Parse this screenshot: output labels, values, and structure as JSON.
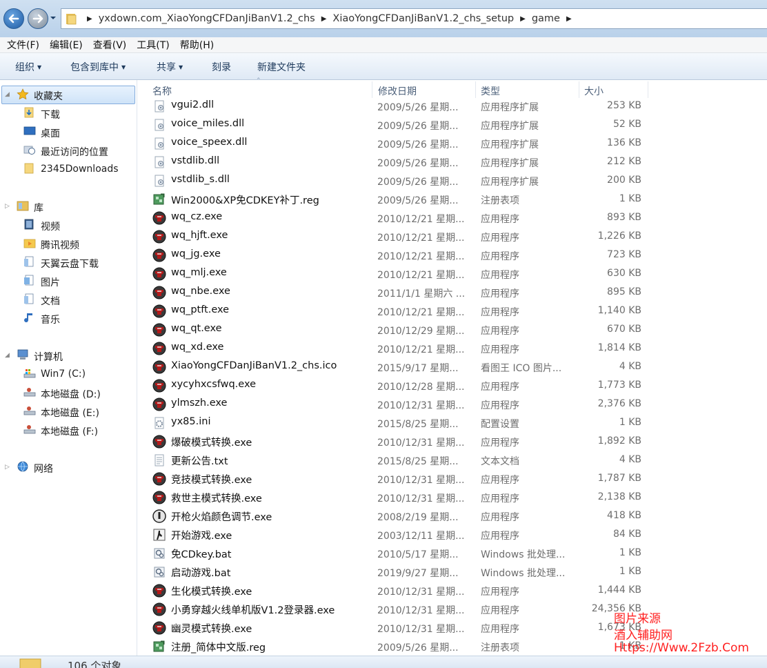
{
  "address_bar": {
    "crumbs": [
      "yxdown.com_XiaoYongCFDanJiBanV1.2_chs",
      "XiaoYongCFDanJiBanV1.2_chs_setup",
      "game"
    ]
  },
  "menu": [
    "文件(F)",
    "编辑(E)",
    "查看(V)",
    "工具(T)",
    "帮助(H)"
  ],
  "toolbar": {
    "organize": "组织",
    "include_library": "包含到库中",
    "share": "共享",
    "burn": "刻录",
    "new_folder": "新建文件夹"
  },
  "nav": {
    "favorites": "收藏夹",
    "fav_items": [
      "下载",
      "桌面",
      "最近访问的位置",
      "2345Downloads"
    ],
    "libraries": "库",
    "lib_items": [
      "视频",
      "腾讯视频",
      "天翼云盘下载",
      "图片",
      "文档",
      "音乐"
    ],
    "computer": "计算机",
    "drives": [
      "Win7 (C:)",
      "本地磁盘 (D:)",
      "本地磁盘 (E:)",
      "本地磁盘 (F:)"
    ],
    "network": "网络"
  },
  "columns": {
    "name": "名称",
    "date": "修改日期",
    "type": "类型",
    "size": "大小"
  },
  "files": [
    {
      "name": "vgui2.dll",
      "date": "2009/5/26 星期...",
      "type": "应用程序扩展",
      "size": "253 KB",
      "icon": "dll"
    },
    {
      "name": "voice_miles.dll",
      "date": "2009/5/26 星期...",
      "type": "应用程序扩展",
      "size": "52 KB",
      "icon": "dll"
    },
    {
      "name": "voice_speex.dll",
      "date": "2009/5/26 星期...",
      "type": "应用程序扩展",
      "size": "136 KB",
      "icon": "dll"
    },
    {
      "name": "vstdlib.dll",
      "date": "2009/5/26 星期...",
      "type": "应用程序扩展",
      "size": "212 KB",
      "icon": "dll"
    },
    {
      "name": "vstdlib_s.dll",
      "date": "2009/5/26 星期...",
      "type": "应用程序扩展",
      "size": "200 KB",
      "icon": "dll"
    },
    {
      "name": "Win2000&XP免CDKEY补丁.reg",
      "date": "2009/5/26 星期...",
      "type": "注册表项",
      "size": "1 KB",
      "icon": "reg"
    },
    {
      "name": "wq_cz.exe",
      "date": "2010/12/21 星期...",
      "type": "应用程序",
      "size": "893 KB",
      "icon": "exe"
    },
    {
      "name": "wq_hjft.exe",
      "date": "2010/12/21 星期...",
      "type": "应用程序",
      "size": "1,226 KB",
      "icon": "exe"
    },
    {
      "name": "wq_jg.exe",
      "date": "2010/12/21 星期...",
      "type": "应用程序",
      "size": "723 KB",
      "icon": "exe"
    },
    {
      "name": "wq_mlj.exe",
      "date": "2010/12/21 星期...",
      "type": "应用程序",
      "size": "630 KB",
      "icon": "exe"
    },
    {
      "name": "wq_nbe.exe",
      "date": "2011/1/1 星期六 ...",
      "type": "应用程序",
      "size": "895 KB",
      "icon": "exe"
    },
    {
      "name": "wq_ptft.exe",
      "date": "2010/12/21 星期...",
      "type": "应用程序",
      "size": "1,140 KB",
      "icon": "exe"
    },
    {
      "name": "wq_qt.exe",
      "date": "2010/12/29 星期...",
      "type": "应用程序",
      "size": "670 KB",
      "icon": "exe"
    },
    {
      "name": "wq_xd.exe",
      "date": "2010/12/21 星期...",
      "type": "应用程序",
      "size": "1,814 KB",
      "icon": "exe"
    },
    {
      "name": "XiaoYongCFDanJiBanV1.2_chs.ico",
      "date": "2015/9/17 星期...",
      "type": "看图王 ICO 图片...",
      "size": "4 KB",
      "icon": "exe"
    },
    {
      "name": "xycyhxcsfwq.exe",
      "date": "2010/12/28 星期...",
      "type": "应用程序",
      "size": "1,773 KB",
      "icon": "exe"
    },
    {
      "name": "ylmszh.exe",
      "date": "2010/12/31 星期...",
      "type": "应用程序",
      "size": "2,376 KB",
      "icon": "exe"
    },
    {
      "name": "yx85.ini",
      "date": "2015/8/25 星期...",
      "type": "配置设置",
      "size": "1 KB",
      "icon": "ini"
    },
    {
      "name": "爆破模式转换.exe",
      "date": "2010/12/31 星期...",
      "type": "应用程序",
      "size": "1,892 KB",
      "icon": "exe"
    },
    {
      "name": "更新公告.txt",
      "date": "2015/8/25 星期...",
      "type": "文本文档",
      "size": "4 KB",
      "icon": "txt"
    },
    {
      "name": "竞技模式转换.exe",
      "date": "2010/12/31 星期...",
      "type": "应用程序",
      "size": "1,787 KB",
      "icon": "exe"
    },
    {
      "name": "救世主模式转换.exe",
      "date": "2010/12/31 星期...",
      "type": "应用程序",
      "size": "2,138 KB",
      "icon": "exe"
    },
    {
      "name": "开枪火焰颜色调节.exe",
      "date": "2008/2/19 星期...",
      "type": "应用程序",
      "size": "418 KB",
      "icon": "fire"
    },
    {
      "name": "开始游戏.exe",
      "date": "2003/12/11 星期...",
      "type": "应用程序",
      "size": "84 KB",
      "icon": "game"
    },
    {
      "name": "免CDkey.bat",
      "date": "2010/5/17 星期...",
      "type": "Windows 批处理...",
      "size": "1 KB",
      "icon": "bat"
    },
    {
      "name": "启动游戏.bat",
      "date": "2019/9/27 星期...",
      "type": "Windows 批处理...",
      "size": "1 KB",
      "icon": "bat"
    },
    {
      "name": "生化模式转换.exe",
      "date": "2010/12/31 星期...",
      "type": "应用程序",
      "size": "1,444 KB",
      "icon": "exe"
    },
    {
      "name": "小勇穿越火线单机版V1.2登录器.exe",
      "date": "2010/12/31 星期...",
      "type": "应用程序",
      "size": "24,356 KB",
      "icon": "exe"
    },
    {
      "name": "幽灵模式转换.exe",
      "date": "2010/12/31 星期...",
      "type": "应用程序",
      "size": "1,673 KB",
      "icon": "exe"
    },
    {
      "name": "注册_简体中文版.reg",
      "date": "2009/5/26 星期...",
      "type": "注册表项",
      "size": "1 KB",
      "icon": "reg"
    }
  ],
  "status": {
    "count": "106 个对象"
  },
  "watermark": {
    "line1": "图片来源",
    "line2": "酒入辅助网",
    "line3": "Https://Www.2Fzb.Com"
  }
}
